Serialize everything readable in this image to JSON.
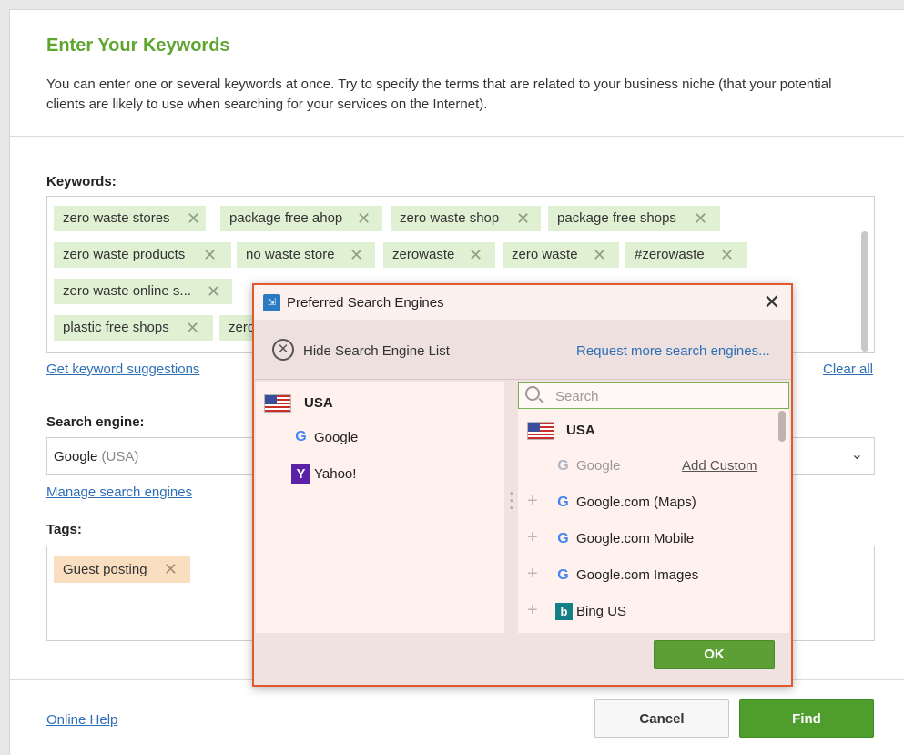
{
  "header": {
    "title": "Enter Your Keywords",
    "description": "You can enter one or several keywords at once. Try to specify the terms that are related to your business niche (that your potential clients are likely to use when searching for your services on the Internet)."
  },
  "keywords": {
    "label": "Keywords:",
    "items": [
      "zero waste stores",
      "package free ahop",
      "zero waste shop",
      "package free shops",
      "zero waste products",
      "no waste store",
      "zerowaste",
      "zero waste",
      "#zerowaste",
      "zero waste online s...",
      "plastic free shops",
      "zero"
    ],
    "remove_glyph": "✕",
    "suggest_link": "Get keyword suggestions",
    "clear_link": "Clear all"
  },
  "search_engine": {
    "label": "Search engine:",
    "value": "Google",
    "value_region": "(USA)",
    "manage_link": "Manage search engines"
  },
  "tags": {
    "label": "Tags:",
    "items": [
      "Guest posting"
    ]
  },
  "footer": {
    "help_link": "Online Help",
    "cancel_label": "Cancel",
    "find_label": "Find"
  },
  "dialog": {
    "title": "Preferred Search Engines",
    "close_glyph": "✕",
    "hide_label": "Hide Search Engine List",
    "request_link": "Request more search engines...",
    "left": {
      "country": "USA",
      "engines": [
        "Google",
        "Yahoo!"
      ]
    },
    "right": {
      "search_placeholder": "Search",
      "country": "USA",
      "disabled_engine": "Google",
      "add_custom": "Add Custom",
      "engines": [
        "Google.com (Maps)",
        "Google.com Mobile",
        "Google.com Images",
        "Bing US"
      ]
    },
    "ok_label": "OK"
  },
  "colors": {
    "accent_green": "#5ea630",
    "link_blue": "#2e6fb7",
    "keyword_tag_bg": "#dff0d3",
    "tag_orange_bg": "#f9dfc0",
    "dialog_border": "#e25a2c"
  }
}
